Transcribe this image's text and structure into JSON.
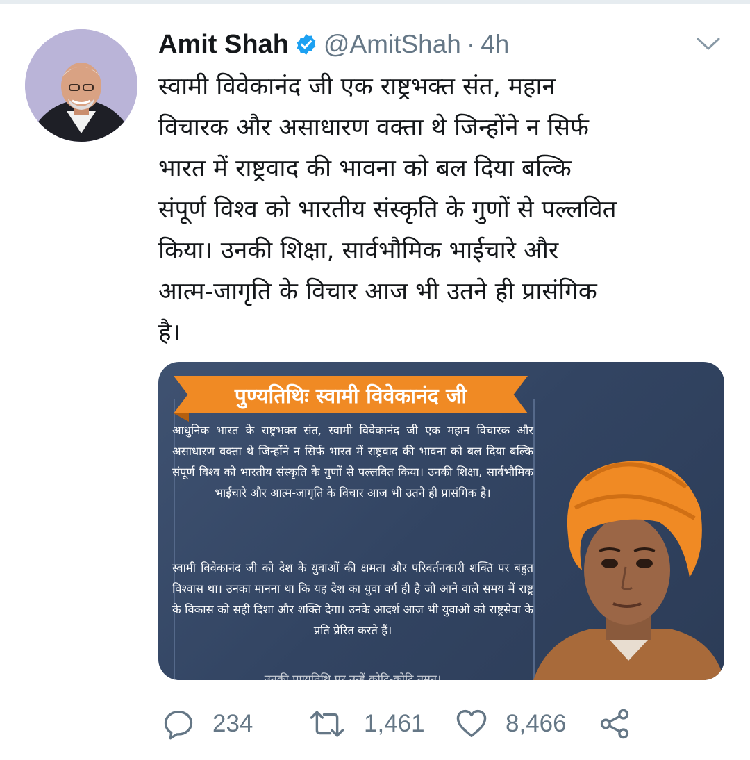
{
  "tweet": {
    "author_name": "Amit Shah",
    "handle": "@AmitShah",
    "separator": "·",
    "time": "4h",
    "text": "स्वामी विवेकानंद जी एक राष्ट्रभक्त संत, महान\nविचारक और असाधारण वक्ता थे जिन्होंने न सिर्फ\nभारत में राष्ट्रवाद की भावना को बल दिया बल्कि\nसंपूर्ण विश्व को भारतीय संस्कृति के गुणों से पल्लवित\nकिया। उनकी शिक्षा, सार्वभौमिक भाईचारे और\nआत्म-जागृति के विचार आज भी उतने ही प्रासंगिक\nहै।",
    "verified": true
  },
  "media": {
    "banner_title": "पुण्यतिथिः स्वामी विवेकानंद जी",
    "paragraph1": "आधुनिक भारत के राष्ट्रभक्त संत, स्वामी विवेकानंद जी एक महान विचारक और असाधारण वक्ता थे जिन्होंने न सिर्फ भारत में राष्ट्रवाद की भावना को बल दिया बल्कि संपूर्ण विश्व को भारतीय संस्कृति के गुणों से पल्लवित किया। उनकी शिक्षा, सार्वभौमिक भाईचारे और आत्म-जागृति के विचार आज भी उतने ही प्रासंगिक है।",
    "paragraph2": "स्वामी विवेकानंद जी को देश के युवाओं की क्षमता और परिवर्तनकारी शक्ति पर बहुत विश्वास था। उनका मानना था कि यह देश का युवा वर्ग ही है जो आने वाले समय में राष्ट्र के विकास को सही दिशा और शक्ति देगा। उनके आदर्श आज भी युवाओं को राष्ट्रसेवा के प्रति प्रेरित करते हैं।",
    "paragraph3": "उनकी पुण्यतिथि पर उन्हें कोटि-कोटि नमन।"
  },
  "actions": {
    "replies": "234",
    "retweets": "1,461",
    "likes": "8,466"
  },
  "icons": {
    "verified": "verified-badge-icon",
    "caret": "chevron-down-icon",
    "reply": "reply-icon",
    "retweet": "retweet-icon",
    "like": "heart-icon",
    "share": "share-icon"
  },
  "colors": {
    "text": "#14171a",
    "secondary": "#657786",
    "verified": "#1da1f2",
    "banner": "#f08a24",
    "media_bg": "#3a4c6b"
  }
}
